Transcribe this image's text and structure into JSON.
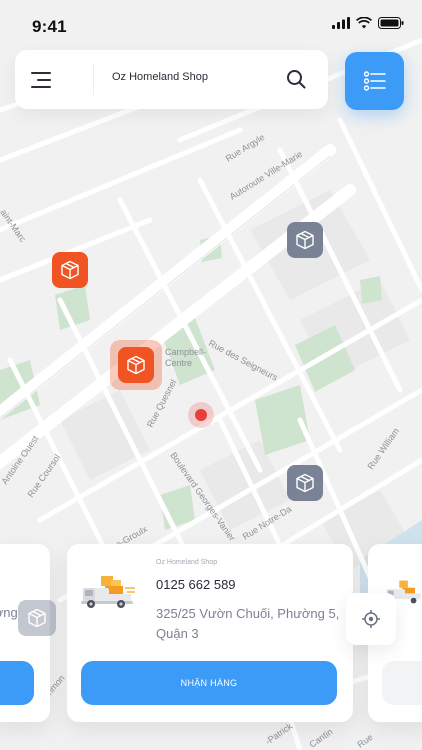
{
  "status_bar": {
    "time": "9:41"
  },
  "header": {
    "shop_name": "Oz Homeland Shop"
  },
  "map": {
    "street_labels": [
      "Rue Argyle",
      "Autoroute Ville-Marie",
      "aint-Marc",
      "Rue des Seigneurs",
      "Campbell-",
      "Centre",
      "Rue Quesnel",
      "Antoine Ouest",
      "Rue Coursol",
      "Boulevard Georges-Vanier",
      "Rue Notre-Da",
      "Rue William",
      "e-Groulx",
      "Rue Richmon",
      "-Patrick",
      "Cantin",
      "Rue"
    ]
  },
  "delivery_card": {
    "shop_name": "Oz Homeland Shop",
    "phone": "0125 662 589",
    "address": "325/25 Vườn Chuối, Phường 5, Quận 3",
    "button_label": "NHẬN HÀNG"
  },
  "prev_card": {
    "partial_text": "ường"
  },
  "colors": {
    "accent": "#3d9bf8",
    "marker_orange": "#f05423",
    "marker_grey": "#7a8396",
    "user_dot": "#e6403a"
  },
  "icons": [
    "menu-icon",
    "search-icon",
    "list-icon",
    "package-icon",
    "truck-icon",
    "locate-icon"
  ]
}
